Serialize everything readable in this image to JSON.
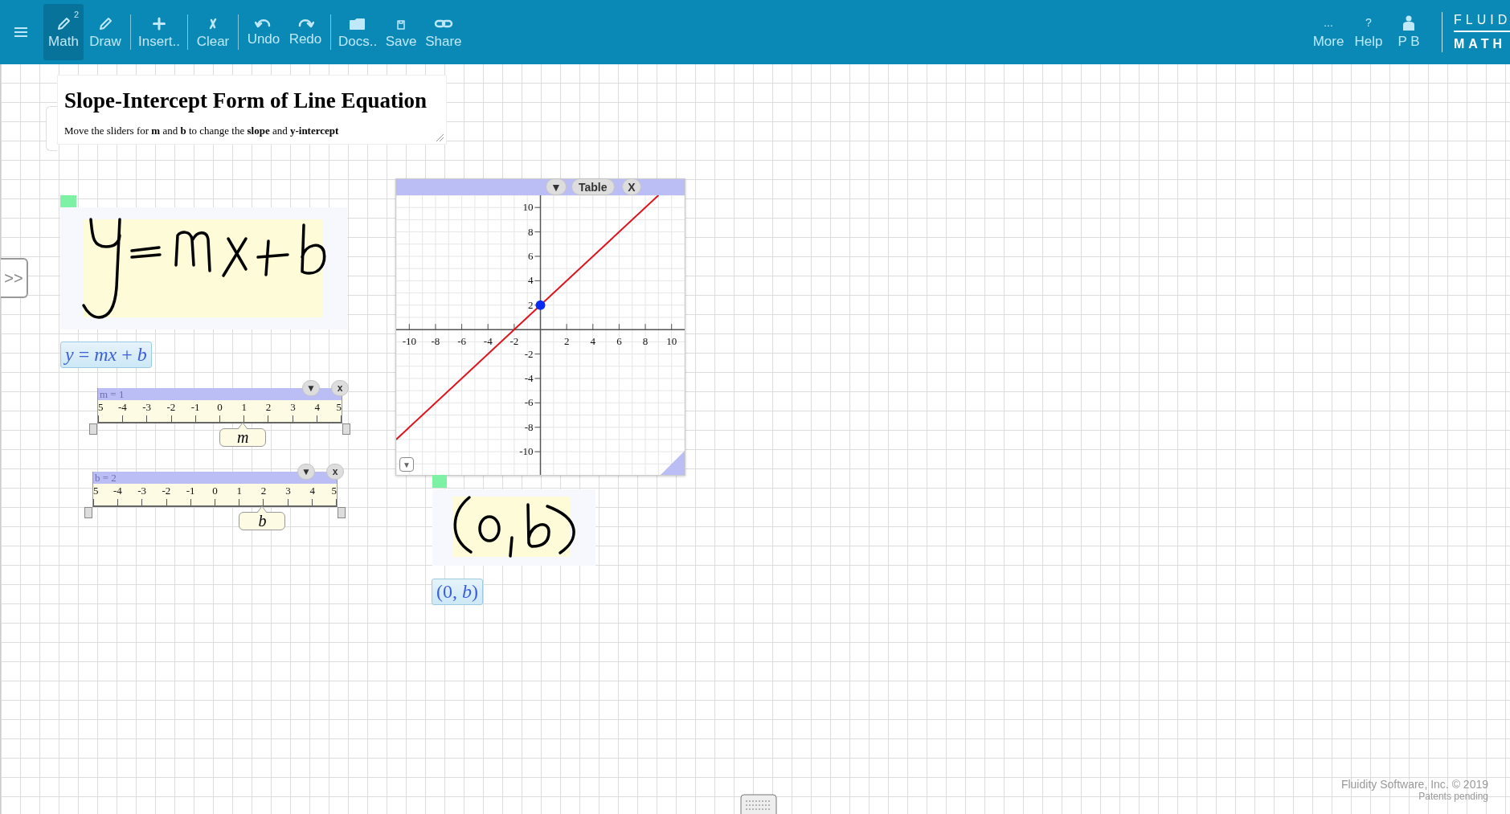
{
  "toolbar": {
    "tool_groups": [
      [
        {
          "label": "Math",
          "selected": true,
          "badge": "2"
        },
        {
          "label": "Draw",
          "selected": false
        }
      ],
      [
        {
          "label": "Insert..",
          "selected": false
        }
      ],
      [
        {
          "label": "Clear",
          "selected": false
        }
      ],
      [
        {
          "label": "Undo",
          "selected": false
        },
        {
          "label": "Redo",
          "selected": false
        }
      ],
      [
        {
          "label": "Docs..",
          "selected": false
        },
        {
          "label": "Save",
          "selected": false
        },
        {
          "label": "Share",
          "selected": false
        }
      ]
    ],
    "right_items": [
      {
        "label": "More",
        "symbol": "..."
      },
      {
        "label": "Help",
        "symbol": "?"
      },
      {
        "label": "P B"
      }
    ],
    "logo": {
      "top": "FLUID",
      "bottom": "MATH"
    }
  },
  "card": {
    "title": "Slope-Intercept Form of Line Equation",
    "description": "Move the sliders for **m** and **b** to change the **slope** and **y-intercept**"
  },
  "side_tab": {
    "label": ">>"
  },
  "expressions": [
    {
      "math": "*y* = *mx* + *b*"
    },
    {
      "math": "(0, *b*)"
    }
  ],
  "sliders": [
    {
      "label": "m = 1",
      "ticks": [
        "5",
        "-4",
        "-3",
        "-2",
        "-1",
        "0",
        "1",
        "2",
        "3",
        "4",
        "5"
      ],
      "variable": "m",
      "menu_button": "▼",
      "close_button": "x"
    },
    {
      "label": "b = 2",
      "ticks": [
        "5",
        "-4",
        "-3",
        "-2",
        "-1",
        "0",
        "1",
        "2",
        "3",
        "4",
        "5"
      ],
      "variable": "b",
      "menu_button": "▼",
      "close_button": "x"
    }
  ],
  "graph": {
    "menu_button": "▼",
    "table_button": "Table",
    "close_button": "X",
    "corner_button": "▼",
    "chart_data": {
      "type": "line",
      "x": [
        -11,
        0,
        9
      ],
      "series": [
        {
          "color": "#e0141e",
          "values": [
            -9,
            2,
            11
          ]
        },
        {
          "color": "#0a2bf0",
          "values": [
            null,
            2,
            null
          ],
          "marker": true
        }
      ],
      "xlim": [
        -11,
        11
      ],
      "ylim": [
        -11.9,
        11
      ],
      "xticks": [
        -10,
        -8,
        -6,
        -4,
        -2,
        2,
        4,
        6,
        8,
        10
      ],
      "yticks": [
        10,
        8,
        6,
        4,
        2,
        -2,
        -4,
        -6,
        -8,
        -10
      ],
      "grid": true
    }
  },
  "footer": {
    "copyright": "Fluidity Software, Inc. © 2019",
    "note": "Patents pending"
  }
}
